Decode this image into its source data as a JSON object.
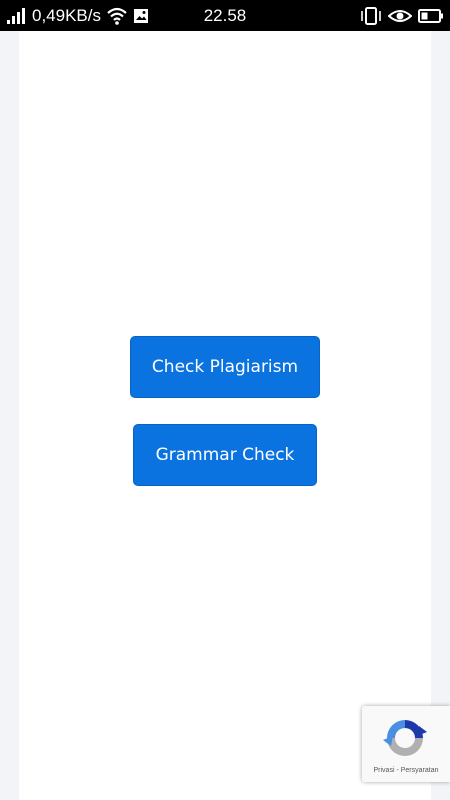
{
  "status_bar": {
    "network_speed": "0,49KB/s",
    "time": "22.58",
    "icons": [
      "signal-icon",
      "wifi-icon",
      "image-icon",
      "vibrate-icon",
      "eye-icon",
      "battery-icon"
    ]
  },
  "main": {
    "buttons": {
      "check_plagiarism": "Check Plagiarism",
      "grammar_check": "Grammar Check"
    }
  },
  "recaptcha": {
    "privacy_label": "Privasi",
    "separator": " - ",
    "terms_label": "Persyaratan"
  },
  "colors": {
    "button_background": "#0a73e0",
    "button_text": "#ffffff",
    "page_background": "#ffffff",
    "outer_background": "#f3f4f8",
    "status_bar_background": "#000000"
  }
}
